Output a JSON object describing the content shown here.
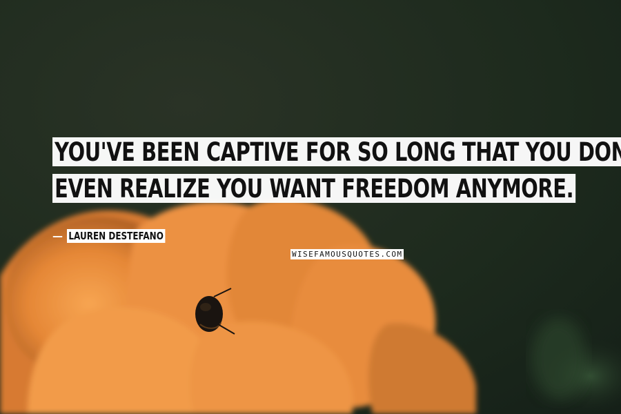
{
  "quote": {
    "line1": "YOU'VE BEEN CAPTIVE FOR SO LONG THAT YOU DON'T",
    "line2": "EVEN REALIZE YOU WANT FREEDOM ANYMORE."
  },
  "author": {
    "dash": "—",
    "name": "LAUREN DESTEFANO"
  },
  "watermark": "WISEFAMOUSQUOTES.COM",
  "colors": {
    "background": "#1b2519",
    "flower": "#e88a38",
    "text_box": "#ffffff",
    "text": "#111111"
  }
}
